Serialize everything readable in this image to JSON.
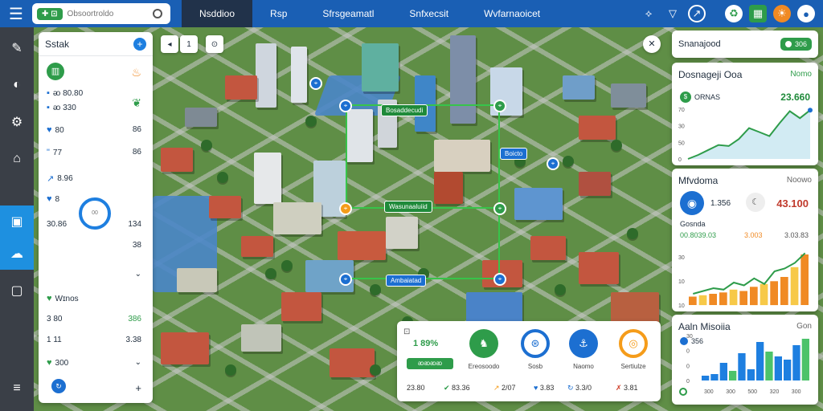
{
  "topbar": {
    "search_logo": "✚ ⊡",
    "search_placeholder": "Obsoortroldo",
    "tabs": [
      "Nsddioo",
      "Rsp",
      "Sfrsgeamatl",
      "Snfxecsit",
      "Wvfarnaoicet"
    ],
    "active_tab": 0
  },
  "leftpanel": {
    "title": "Sstak",
    "rows": [
      {
        "label": "ᴔ 80.80",
        "right": ""
      },
      {
        "label": "ᴔ 330",
        "right": ""
      },
      {
        "label": "80",
        "right": "86"
      },
      {
        "label": "77",
        "right": "86"
      },
      {
        "label": "8.96",
        "right": ""
      },
      {
        "label": "8",
        "right": ""
      },
      {
        "label": "30.86",
        "right": "134"
      },
      {
        "label": "",
        "right": "38"
      },
      {
        "label": "Wɪnos",
        "right": ""
      },
      {
        "label": "3 80",
        "right": "386"
      },
      {
        "label": "1 11",
        "right": "3.38"
      },
      {
        "label": "300",
        "right": ""
      }
    ],
    "ring_text": "00"
  },
  "map_labels": [
    {
      "text": "Bosaddecudi"
    },
    {
      "text": "Wasunaaluiid"
    },
    {
      "text": "Boicto"
    },
    {
      "text": "Ambaiatad"
    }
  ],
  "bottom_widget": {
    "metric_label": "1 89%",
    "bar_label": "ᴔᴔᴔᴔ",
    "circles": [
      {
        "label": "Ereosoodo",
        "color": "#2e9c4a",
        "glyph": "♞"
      },
      {
        "label": "Sosb",
        "color": "#1c6fd1",
        "glyph": "⊛"
      },
      {
        "label": "Naomo",
        "color": "#1c6fd1",
        "glyph": "⚓"
      },
      {
        "label": "Sertiulze",
        "color": "#f59c1a",
        "glyph": "◎"
      }
    ],
    "footer": [
      "23.80",
      "83.36",
      "2/07",
      "3.83",
      "3.3/0",
      "3.81"
    ]
  },
  "right_panels": {
    "header_title": "Snanajood",
    "header_toggle": "306",
    "card1": {
      "title": "Dosnageji Ooa",
      "sub": "Nomo",
      "metric_label": "ORNAS",
      "metric_value": "23.660"
    },
    "card2": {
      "title": "Mfvdoma",
      "sub": "Noowo",
      "stat1": "1.356",
      "stat2": "43.100",
      "row_label": "Gosnda",
      "row_a": "00.8039.03",
      "row_b": "3.003",
      "row_c": "3.03.83"
    },
    "card3": {
      "title": "Aaln Misoiia",
      "sub": "Gon",
      "legend": "356"
    }
  },
  "chart_data": [
    {
      "type": "area",
      "title": "Dosnageji Ooa",
      "y_ticks": [
        "70",
        "30",
        "50",
        "0"
      ],
      "values": [
        0,
        8,
        18,
        28,
        26,
        40,
        62,
        54,
        46,
        72,
        96,
        82,
        98
      ]
    },
    {
      "type": "bar",
      "title": "Mfvdoma",
      "y_ticks": [
        "30",
        "10",
        "10"
      ],
      "values": [
        12,
        14,
        16,
        18,
        22,
        20,
        26,
        30,
        34,
        40,
        54,
        72
      ],
      "line": [
        16,
        20,
        24,
        22,
        32,
        28,
        38,
        30,
        48,
        52,
        60,
        74
      ]
    },
    {
      "type": "bar",
      "title": "Aaln Misoiia",
      "y_ticks": [
        "30",
        "0",
        "0",
        "0"
      ],
      "categories": [
        "300",
        "300",
        "500",
        "320",
        "300"
      ],
      "series": [
        {
          "values": [
            6,
            8,
            22,
            12,
            34,
            14,
            48,
            36,
            30,
            26,
            44,
            52
          ]
        }
      ]
    }
  ]
}
